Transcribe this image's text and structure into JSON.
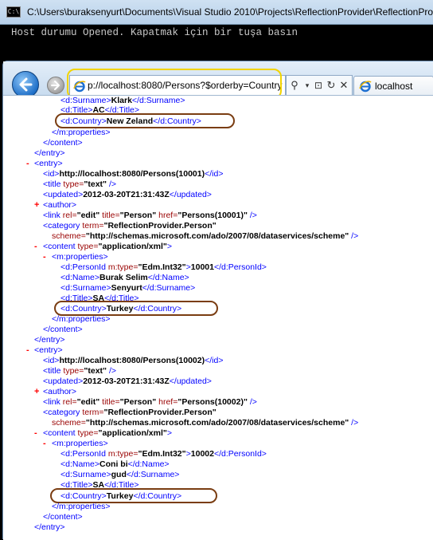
{
  "console": {
    "title": "C:\\Users\\buraksenyurt\\Documents\\Visual Studio 2010\\Projects\\ReflectionProvider\\ReflectionProvider",
    "output": "Host durumu Opened. Kapatmak için bir tuşa basın"
  },
  "browser": {
    "address": "p://localhost:8080/Persons?$orderby=Country",
    "tab_label": "localhost",
    "icons": [
      "back-arrow-icon",
      "forward-arrow-icon",
      "ie-page-icon",
      "search-icon",
      "compatibility-icon",
      "refresh-icon",
      "close-icon"
    ]
  },
  "xml": {
    "top": {
      "surname_open": "<d:Surname>",
      "surname_val": "Klark",
      "surname_close": "</d:Surname>",
      "title_open": "<d:Title>",
      "title_val": "AC",
      "title_close": "</d:Title>",
      "country_open": "<d:Country>",
      "country_val": "New Zeland",
      "country_close": "</d:Country>",
      "props_close": "</m:properties>",
      "content_close": "</content>",
      "entry_close": "</entry>"
    },
    "entry1": {
      "entry_open": "<entry>",
      "id_open": "<id>",
      "id_val": "http://localhost:8080/Persons(10001)",
      "id_close": "</id>",
      "title_tag": "<title",
      "title_attr": " type=",
      "title_attr_val": "\"text\"",
      "title_end": " />",
      "updated_open": "<updated>",
      "updated_val": "2012-03-20T21:31:43Z",
      "updated_close": "</updated>",
      "author": "<author>",
      "link_tag": "<link",
      "link_rel": " rel=",
      "link_rel_val": "\"edit\"",
      "link_title": " title=",
      "link_title_val": "\"Person\"",
      "link_href": " href=",
      "link_href_val": "\"Persons(10001)\"",
      "link_end": " />",
      "category_tag": "<category",
      "category_term": " term=",
      "category_term_val": "\"ReflectionProvider.Person\"",
      "scheme": "scheme=",
      "scheme_val": "\"http://schemas.microsoft.com/ado/2007/08/dataservices/scheme\"",
      "scheme_end": " />",
      "content_tag": "<content",
      "content_type": " type=",
      "content_type_val": "\"application/xml\"",
      "content_end": ">",
      "props_open": "<m:properties>",
      "personid_open": "<d:PersonId",
      "personid_attr": " m:type=",
      "personid_attr_val": "\"Edm.Int32\"",
      "personid_gt": ">",
      "personid_val": "10001",
      "personid_close": "</d:PersonId>",
      "name_open": "<d:Name>",
      "name_val": "Burak Selim",
      "name_close": "</d:Name>",
      "surname_open": "<d:Surname>",
      "surname_val": "Senyurt",
      "surname_close": "</d:Surname>",
      "title2_open": "<d:Title>",
      "title2_val": "SA",
      "title2_close": "</d:Title>",
      "country_open": "<d:Country>",
      "country_val": "Turkey",
      "country_close": "</d:Country>",
      "props_close": "</m:properties>",
      "content_close": "</content>",
      "entry_close": "</entry>"
    },
    "entry2": {
      "entry_open": "<entry>",
      "id_open": "<id>",
      "id_val": "http://localhost:8080/Persons(10002)",
      "id_close": "</id>",
      "title_tag": "<title",
      "title_attr": " type=",
      "title_attr_val": "\"text\"",
      "title_end": " />",
      "updated_open": "<updated>",
      "updated_val": "2012-03-20T21:31:43Z",
      "updated_close": "</updated>",
      "author": "<author>",
      "link_tag": "<link",
      "link_rel": " rel=",
      "link_rel_val": "\"edit\"",
      "link_title": " title=",
      "link_title_val": "\"Person\"",
      "link_href": " href=",
      "link_href_val": "\"Persons(10002)\"",
      "link_end": " />",
      "category_tag": "<category",
      "category_term": " term=",
      "category_term_val": "\"ReflectionProvider.Person\"",
      "scheme": "scheme=",
      "scheme_val": "\"http://schemas.microsoft.com/ado/2007/08/dataservices/scheme\"",
      "scheme_end": " />",
      "content_tag": "<content",
      "content_type": " type=",
      "content_type_val": "\"application/xml\"",
      "content_end": ">",
      "props_open": "<m:properties>",
      "personid_open": "<d:PersonId",
      "personid_attr": " m:type=",
      "personid_attr_val": "\"Edm.Int32\"",
      "personid_gt": ">",
      "personid_val": "10002",
      "personid_close": "</d:PersonId>",
      "name_open": "<d:Name>",
      "name_val": "Coni bi",
      "name_close": "</d:Name>",
      "surname_open": "<d:Surname>",
      "surname_val": "gud",
      "surname_close": "</d:Surname>",
      "title2_open": "<d:Title>",
      "title2_val": "SA",
      "title2_close": "</d:Title>",
      "country_open": "<d:Country>",
      "country_val": "Turkey",
      "country_close": "</d:Country>",
      "props_close": "</m:properties>",
      "content_close": "</content>",
      "entry_close": "</entry>"
    },
    "toggle_minus": "-",
    "toggle_plus": "+"
  }
}
